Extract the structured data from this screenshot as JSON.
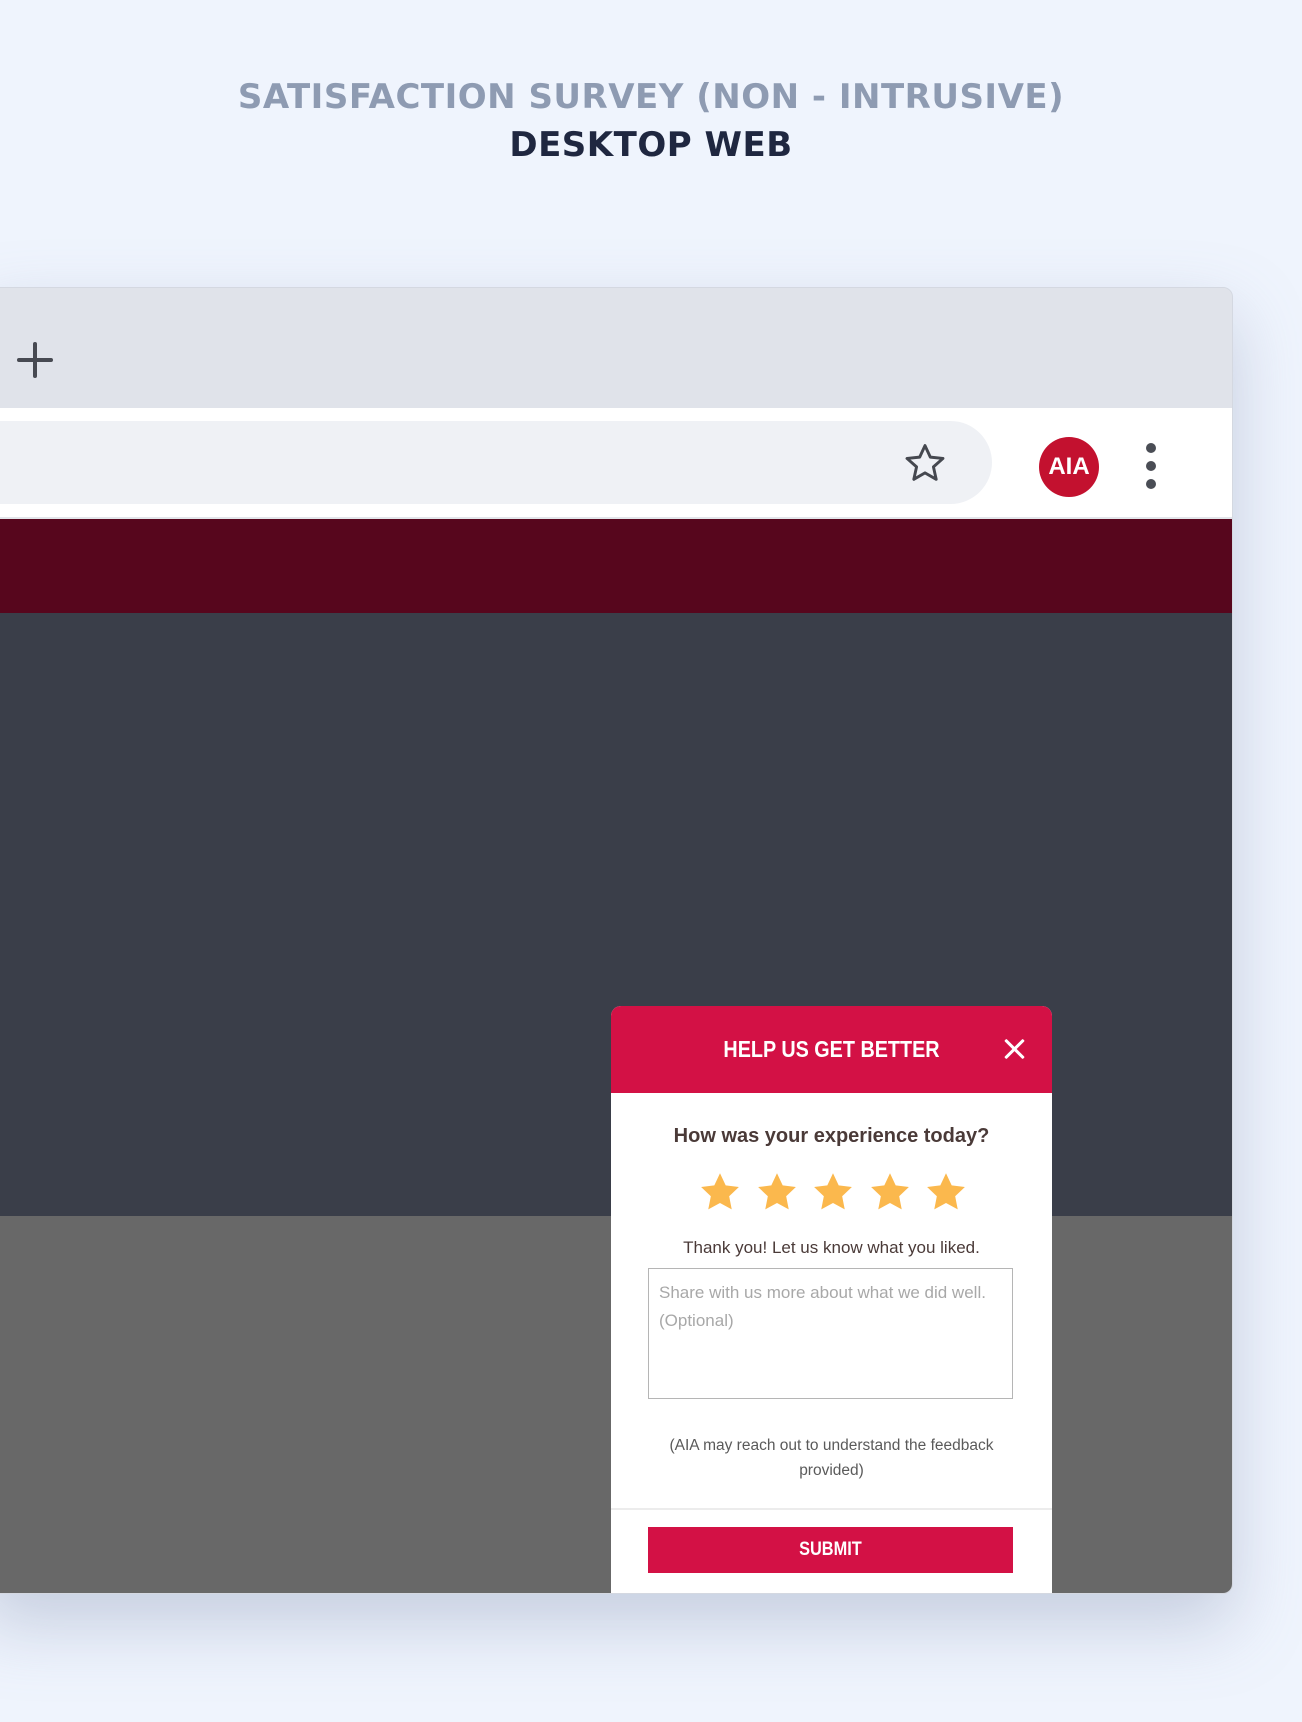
{
  "page": {
    "heading_line1": "SATISFACTION SURVEY (NON - INTRUSIVE)",
    "heading_line2": "DESKTOP WEB"
  },
  "browser": {
    "new_tab_icon": "plus-icon",
    "bookmark_icon": "star-outline-icon",
    "profile_label": "AIA",
    "menu_icon": "kebab-menu-icon"
  },
  "colors": {
    "page_background": "#eff4fd",
    "site_header": "#57061d",
    "hero": "#3a3e49",
    "content_area": "#686868",
    "brand_red": "#d31145",
    "star": "#fbb84d"
  },
  "survey": {
    "title": "HELP US GET BETTER",
    "close_icon": "close-icon",
    "question": "How was your experience today?",
    "rating": 5,
    "rating_max": 5,
    "thanks": "Thank you! Let us know what you liked.",
    "feedback_value": "",
    "feedback_placeholder": "Share with us more about what we did well. (Optional)",
    "note": "(AIA may reach out to understand the feedback provided)",
    "submit_label": "SUBMIT"
  }
}
